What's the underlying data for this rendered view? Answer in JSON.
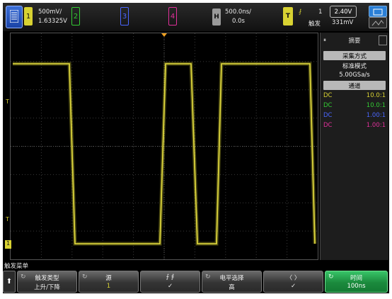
{
  "top_bar": {
    "ch1": {
      "number": "1",
      "scale": "500mV/",
      "offset": "1.63325V",
      "color": "#d8d232"
    },
    "ch2": {
      "number": "2",
      "color": "#33cc33"
    },
    "ch3": {
      "number": "3",
      "color": "#4a66ff"
    },
    "ch4": {
      "number": "4",
      "color": "#e0309a"
    },
    "horizontal": {
      "badge": "H",
      "time_scale": "500.0ns/",
      "delay": "0.0s"
    },
    "trigger": {
      "badge": "T",
      "edge_symbol": "⨏",
      "source": "1",
      "level": "2.40V",
      "mode": "触发",
      "level2": "331mV"
    }
  },
  "panel": {
    "tab_label": "摘要",
    "acquire_header": "采集方式",
    "acquire_mode": "标准模式",
    "sample_rate": "5.00GSa/s",
    "channels_header": "通道",
    "channels": [
      {
        "coupling": "DC",
        "probe": "10.0:1",
        "color": "#d8d232"
      },
      {
        "coupling": "DC",
        "probe": "10.0:1",
        "color": "#33cc33"
      },
      {
        "coupling": "DC",
        "probe": "1.00:1",
        "color": "#4a66ff"
      },
      {
        "coupling": "DC",
        "probe": "1.00:1",
        "color": "#e0309a"
      }
    ]
  },
  "markers": {
    "trigger_marker_1": "T",
    "trigger_marker_2": "T",
    "ch1_marker": "1"
  },
  "menu": {
    "title": "触发菜单",
    "softkeys": [
      {
        "line1": "触发类型",
        "line2": "上升/下降"
      },
      {
        "line1": "源",
        "line2": "1"
      },
      {
        "line1": "⨍          ⨎",
        "line2": "✓"
      },
      {
        "line1": "电平选择",
        "line2": "高"
      },
      {
        "line1": "〈          〉",
        "line2": "✓"
      },
      {
        "line1": "时间",
        "line2": "100ns"
      }
    ]
  },
  "icons": {
    "menu": "menu-icon",
    "run": "run-icon",
    "back": "up-arrow-icon"
  }
}
